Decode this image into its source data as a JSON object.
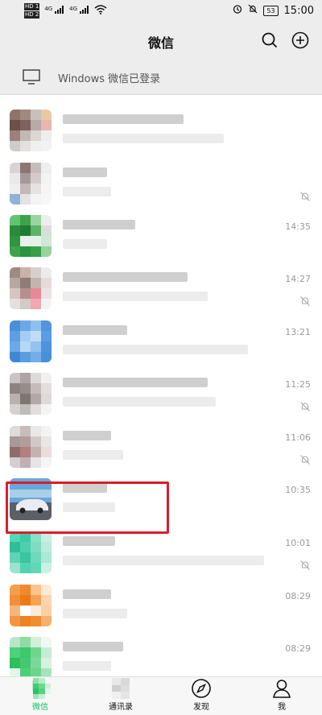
{
  "status": {
    "sim1": "HD 1",
    "sim2": "HD 2",
    "net1": "4G",
    "net2": "4G",
    "battery": "53",
    "time": "15:00"
  },
  "header": {
    "title": "微信"
  },
  "banner": {
    "text": "Windows 微信已登录"
  },
  "chats": [
    {
      "time": "",
      "muted": false,
      "colors": [
        "#8d7368",
        "#a08a80",
        "#c9c0bd",
        "#e8c9a4",
        "#6d4f4c",
        "#7e625d",
        "#b8aaa6",
        "#e7b7b0",
        "#9b817c",
        "#c4b8b5",
        "#dcd6d4",
        "#eeeeee",
        "#d0cbc9",
        "#e4e0df",
        "#f0f0f0",
        "#f3f3f3"
      ]
    },
    {
      "time": "",
      "muted": true,
      "colors": [
        "#d8d4d4",
        "#8c7674",
        "#c6bcbb",
        "#eeeeee",
        "#ece8e8",
        "#a69a99",
        "#d3cccb",
        "#f3f3f3",
        "#f0eeee",
        "#c2b8b7",
        "#e6e2e2",
        "#f5f5f5",
        "#8fb3d6",
        "#e3e3e3",
        "#f4f4f4",
        "#f7f7f7"
      ]
    },
    {
      "time": "14:35",
      "muted": false,
      "colors": [
        "#62c36e",
        "#3da24c",
        "#9ad4a0",
        "#eeeeee",
        "#2b8a3c",
        "#1f7d33",
        "#5bb568",
        "#dcdcdc",
        "#2f9540",
        "#e6f2e7",
        "#e6f2e7",
        "#cfe8d2",
        "#3ea34e",
        "#2b9240",
        "#37a049",
        "#9ad19f"
      ]
    },
    {
      "time": "14:27",
      "muted": true,
      "colors": [
        "#9e8a80",
        "#c9b3a8",
        "#d7cfcb",
        "#ececec",
        "#b7a7a2",
        "#8f7c76",
        "#c3b4af",
        "#e5dcd9",
        "#d4c7c3",
        "#b58f8e",
        "#e58a96",
        "#e9e4e2",
        "#e4e0de",
        "#d3c9c6",
        "#f0a8b2",
        "#f3f3f3"
      ]
    },
    {
      "time": "13:21",
      "muted": false,
      "colors": [
        "#4a90d9",
        "#6aa8e6",
        "#8ec0ef",
        "#4f96de",
        "#5c9fe2",
        "#a5cdf3",
        "#c2dcf6",
        "#5a9de1",
        "#6ba9e7",
        "#b8d6f5",
        "#93c2ef",
        "#4d93dc",
        "#3f88d6",
        "#5a9ee2",
        "#74aee9",
        "#4990db"
      ]
    },
    {
      "time": "11:25",
      "muted": true,
      "colors": [
        "#c9c3c3",
        "#ada5a5",
        "#dedada",
        "#f0f0f0",
        "#8d8282",
        "#978c8a",
        "#c4bbba",
        "#e3dede",
        "#b9b1b0",
        "#7f7573",
        "#b1a8a7",
        "#dfd9d8",
        "#d6d2d2",
        "#c1bbba",
        "#e2dede",
        "#f4f4f4"
      ]
    },
    {
      "time": "11:06",
      "muted": true,
      "colors": [
        "#e0dada",
        "#c8bcbb",
        "#ebe7e7",
        "#f3f3f3",
        "#a79998",
        "#b29d9b",
        "#d1c8c7",
        "#eae6e6",
        "#8d6d6b",
        "#b47f7f",
        "#c4b2b1",
        "#ecdcdc",
        "#d6cece",
        "#bfb1b0",
        "#e8e4e4",
        "#f5f5f5"
      ]
    },
    {
      "time": "10:35",
      "muted": false,
      "car": true
    },
    {
      "time": "10:01",
      "muted": true,
      "colors": [
        "#56d6b4",
        "#3ecaa5",
        "#88e0c8",
        "#c5efe3",
        "#2fbf98",
        "#4cd0ae",
        "#7fdcc2",
        "#b9ebdd",
        "#5fd5b5",
        "#38c59f",
        "#6dd9bd",
        "#a9e7d6",
        "#9ae3cf",
        "#52d2b0",
        "#63d6b7",
        "#c8f0e4"
      ]
    },
    {
      "time": "08:29",
      "muted": false,
      "colors": [
        "#f49d4a",
        "#f08a2c",
        "#fbc48e",
        "#fde9d4",
        "#f28f34",
        "#e97a18",
        "#f5a352",
        "#fbd5b0",
        "#f6b57a",
        "#ffffff",
        "#fdebd8",
        "#fbd0a4",
        "#f39540",
        "#ec8222",
        "#f08d30",
        "#f6b06a"
      ]
    },
    {
      "time": "08:29",
      "muted": false,
      "colors": [
        "#b9e6c4",
        "#8fdba2",
        "#d0eed8",
        "#eef9f1",
        "#4fd07c",
        "#3cc96c",
        "#6fd690",
        "#c6ecd1",
        "#2cbf5e",
        "#45c873",
        "#7ad89a",
        "#d6f2df",
        "#e3f6e9",
        "#4dce79",
        "#6ad58d",
        "#a7e3b8"
      ]
    }
  ],
  "tabs": [
    {
      "label": "微信"
    },
    {
      "label": "通讯录"
    },
    {
      "label": "发现"
    },
    {
      "label": "我"
    }
  ],
  "colors": {
    "accent": "#07c160",
    "highlight": "#d81e2c"
  }
}
